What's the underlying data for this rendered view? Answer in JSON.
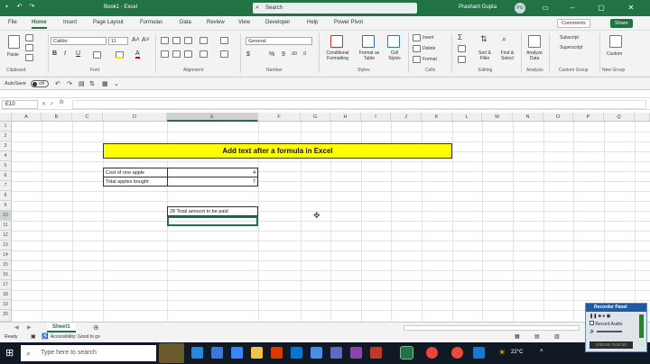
{
  "title": {
    "text": "Book1 - Excel",
    "search_placeholder": "Search",
    "user": "Prashant Gupta",
    "avatar": "PG"
  },
  "menu": {
    "tabs": [
      "File",
      "Home",
      "Insert",
      "Page Layout",
      "Formulas",
      "Data",
      "Review",
      "View",
      "Developer",
      "Help",
      "Power Pivot"
    ],
    "comments_label": "Comments",
    "share_label": "Share"
  },
  "ribbon": {
    "paste": "Paste",
    "font_name": "Calibri",
    "font_size": "11",
    "number_format": "General",
    "styles": [
      "Conditional Formatting",
      "Format as Table",
      "Cell Styles"
    ],
    "cells": [
      "Insert",
      "Delete",
      "Format"
    ],
    "editing": [
      "Sort & Filter",
      "Find & Select"
    ],
    "analyze": "Analyze Data",
    "subscript": "Subscript",
    "superscript": "Superscript",
    "custom": "Custom",
    "groups": [
      "Clipboard",
      "Font",
      "Alignment",
      "Number",
      "Styles",
      "Cells",
      "Editing",
      "Analysis",
      "Custom Group",
      "New Group"
    ]
  },
  "qat": {
    "autosave": "AutoSave",
    "toggle": "Off"
  },
  "formula_bar": {
    "name_box": "E10",
    "fx": "fx",
    "content": ""
  },
  "grid": {
    "columns": [
      "A",
      "B",
      "C",
      "D",
      "E",
      "F",
      "G",
      "H",
      "I",
      "J",
      "K",
      "L",
      "M",
      "N",
      "O",
      "P",
      "Q"
    ],
    "rows": [
      "1",
      "2",
      "3",
      "4",
      "5",
      "6",
      "7",
      "8",
      "9",
      "10",
      "11",
      "12",
      "13",
      "14",
      "15",
      "16",
      "17",
      "18",
      "19",
      "20"
    ]
  },
  "sheet": {
    "banner": "Add text after a formula in Excel",
    "label1": "Cost of one apple",
    "value1": "4",
    "label2": "Total apples bought",
    "value2": "7",
    "e9": "28 Total amount to be paid"
  },
  "sheet_tabs": {
    "active": "Sheet1"
  },
  "status": {
    "ready": "Ready",
    "accessibility": "Accessibility: Good to go"
  },
  "taskbar": {
    "search": "Type here to search",
    "temp": "22°C"
  },
  "recorder": {
    "title": "Recorder Panel",
    "record_audio": "Record Audio",
    "time": "0:00:45 / 0:00:10"
  }
}
